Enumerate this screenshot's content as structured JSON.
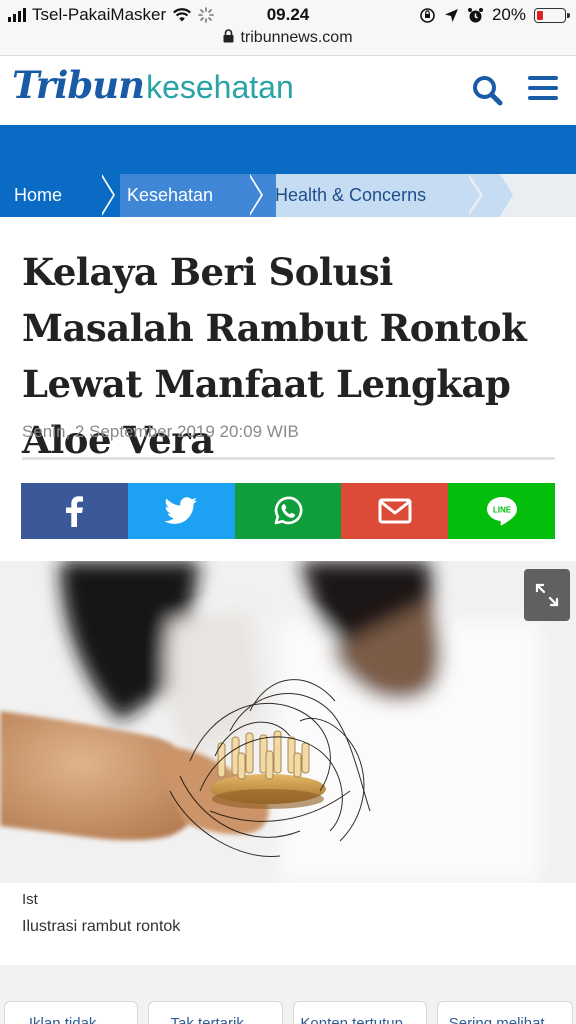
{
  "status_bar": {
    "carrier": "Tsel-PakaiMasker",
    "time": "09.24",
    "battery": "20%",
    "battery_level": 0.2,
    "url": "tribunnews.com"
  },
  "header": {
    "logo_tribun": "Tribun",
    "logo_section": "kesehatan",
    "brand_color": "#1a5ba8",
    "accent_color": "#2aa3a6"
  },
  "breadcrumb": [
    {
      "label": "Home"
    },
    {
      "label": "Kesehatan"
    },
    {
      "label": "Health & Concerns"
    }
  ],
  "article": {
    "title": "Kelaya Beri Solusi Masalah Rambut Rontok Lewat Manfaat Lengkap Aloe Vera",
    "date": "Senin, 2 September 2019 20:09 WIB",
    "image_credit": "Ist",
    "image_caption": "Ilustrasi rambut rontok"
  },
  "share": [
    {
      "network": "facebook",
      "icon": "facebook-icon",
      "color": "#3b5998"
    },
    {
      "network": "twitter",
      "icon": "twitter-icon",
      "color": "#1da1f2"
    },
    {
      "network": "whatsapp",
      "icon": "whatsapp-icon",
      "color": "#109e3c"
    },
    {
      "network": "email",
      "icon": "email-icon",
      "color": "#dc4a38"
    },
    {
      "network": "line",
      "icon": "line-icon",
      "label": "LINE",
      "color": "#04be0c"
    }
  ],
  "feedback": {
    "buttons": [
      "Iklan tidak ...",
      "Tak tertarik ...",
      "Konten tertutup ...",
      "Sering melihat ..."
    ]
  }
}
